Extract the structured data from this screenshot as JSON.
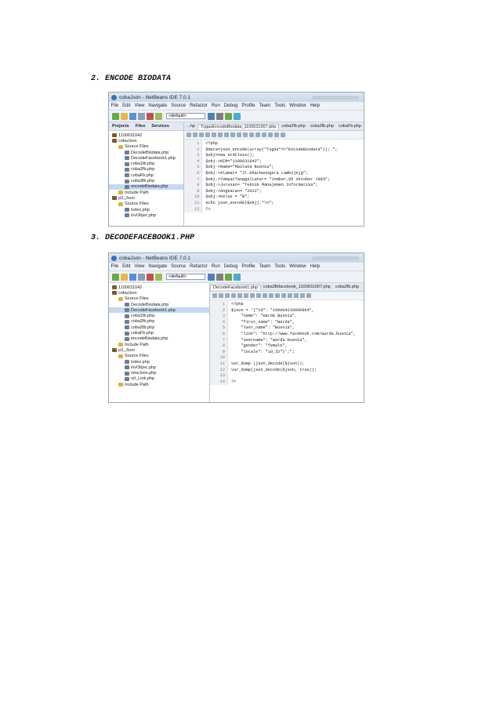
{
  "sections": [
    {
      "heading": "2. ENCODE BIODATA",
      "window_title": "cobaJson - NetBeans IDE 7.0.1",
      "menu": [
        "File",
        "Edit",
        "View",
        "Navigate",
        "Source",
        "Refactor",
        "Run",
        "Debug",
        "Profile",
        "Team",
        "Tools",
        "Window",
        "Help"
      ],
      "config_value": "<default>",
      "panel_tabs": [
        "Projects",
        "Files",
        "Services"
      ],
      "tree": [
        {
          "label": "1100631042",
          "depth": 0,
          "kind": "project"
        },
        {
          "label": "cobaJson",
          "depth": 0,
          "kind": "project"
        },
        {
          "label": "Source Files",
          "depth": 1,
          "kind": "folder"
        },
        {
          "label": "DecodeBiodata.php",
          "depth": 2,
          "kind": "file"
        },
        {
          "label": "DecodeFacebook1.php",
          "depth": 2,
          "kind": "file"
        },
        {
          "label": "coba1fb.php",
          "depth": 2,
          "kind": "file"
        },
        {
          "label": "coba2fb.php",
          "depth": 2,
          "kind": "file"
        },
        {
          "label": "cobaFb.php",
          "depth": 2,
          "kind": "file"
        },
        {
          "label": "coba3fb.php",
          "depth": 2,
          "kind": "file"
        },
        {
          "label": "encodeBiodata.php",
          "depth": 2,
          "kind": "file",
          "selected": true
        },
        {
          "label": "Include Path",
          "depth": 1,
          "kind": "folder"
        },
        {
          "label": "p3_Json",
          "depth": 0,
          "kind": "project"
        },
        {
          "label": "Source Files",
          "depth": 1,
          "kind": "folder"
        },
        {
          "label": "index.php",
          "depth": 2,
          "kind": "file"
        },
        {
          "label": "invObjec.php",
          "depth": 2,
          "kind": "file"
        }
      ],
      "editor_tabs": [
        "...hp",
        "TugasEncodeBiodata_1100631007.php",
        "coba2fb.php",
        "coba2fb.php",
        "cobaFb.php"
      ],
      "active_tab": 1,
      "code_lines": [
        "<?php",
        "$data=json_encode(array(\"Tugas\"=>\"EncodeBiodata\"));.\";",
        "$obj=new stdClass();",
        "$obj->NIM=\"1100631042\";",
        "$obj->Nama=\"Maulana Busnia\";",
        "$obj->Alamat= \"Jl.Gharbanegera Lambijejg\";",
        "$obj->TempatTanggalLahir= \"Jombor,05 oktober 1993\";",
        "$obj->Jurusan= \"Teknik Manajemen Informatika\";",
        "$obj->Angkatan= \"2011\";",
        "$obj->Kelas = \"B\";",
        "echo json_encode($obj).\"\\n\";",
        "?>"
      ]
    },
    {
      "heading": "3. DECODEFACEBOOK1.PHP",
      "window_title": "cobaJson - NetBeans IDE 7.0.1",
      "menu": [
        "File",
        "Edit",
        "View",
        "Navigate",
        "Source",
        "Refactor",
        "Run",
        "Debug",
        "Profile",
        "Team",
        "Tools",
        "Window",
        "Help"
      ],
      "config_value": "<default>",
      "panel_tabs": [],
      "tree": [
        {
          "label": "1100631042",
          "depth": 0,
          "kind": "project"
        },
        {
          "label": "cobaJson",
          "depth": 0,
          "kind": "project"
        },
        {
          "label": "Source Files",
          "depth": 1,
          "kind": "folder"
        },
        {
          "label": "DecodeBiodata.php",
          "depth": 2,
          "kind": "file"
        },
        {
          "label": "DecodeFacebook1.php",
          "depth": 2,
          "kind": "file",
          "selected": true
        },
        {
          "label": "coba1fb.php",
          "depth": 2,
          "kind": "file"
        },
        {
          "label": "coba2fb.php",
          "depth": 2,
          "kind": "file"
        },
        {
          "label": "coba2fb.php",
          "depth": 2,
          "kind": "file"
        },
        {
          "label": "cobaFb.php",
          "depth": 2,
          "kind": "file"
        },
        {
          "label": "encodeBiodata.php",
          "depth": 2,
          "kind": "file"
        },
        {
          "label": "Include Path",
          "depth": 1,
          "kind": "folder"
        },
        {
          "label": "p3_Json",
          "depth": 0,
          "kind": "project"
        },
        {
          "label": "Source Files",
          "depth": 1,
          "kind": "folder"
        },
        {
          "label": "index.php",
          "depth": 2,
          "kind": "file"
        },
        {
          "label": "invObjec.php",
          "depth": 2,
          "kind": "file"
        },
        {
          "label": "newJson.php",
          "depth": 2,
          "kind": "file"
        },
        {
          "label": "url_Link.php",
          "depth": 2,
          "kind": "file"
        },
        {
          "label": "Include Path",
          "depth": 1,
          "kind": "folder"
        }
      ],
      "editor_tabs": [
        "DecodeFacebook1.php",
        "coba3fbfacebook_1100631007.php",
        "coba2fb.php"
      ],
      "active_tab": 0,
      "code_lines": [
        "<?php",
        "$json = '{\"id\": \"100004216098904\",",
        "    \"name\": \"Warda Busnia\",",
        "    \"first_name\": \"Warda\",",
        "    \"last_name\": \"Busnia\",",
        "    \"link\": \"http://www.facebook.com/warda.busnia\",",
        "    \"username\": \"warda.busnia\",",
        "    \"gender\": \"female\",",
        "    \"locale\": \"id_ID\"}';\";",
        "",
        "var_dump (json_decode($json));",
        "var_dump(json_decode($json, true));",
        "",
        "?>"
      ]
    }
  ]
}
